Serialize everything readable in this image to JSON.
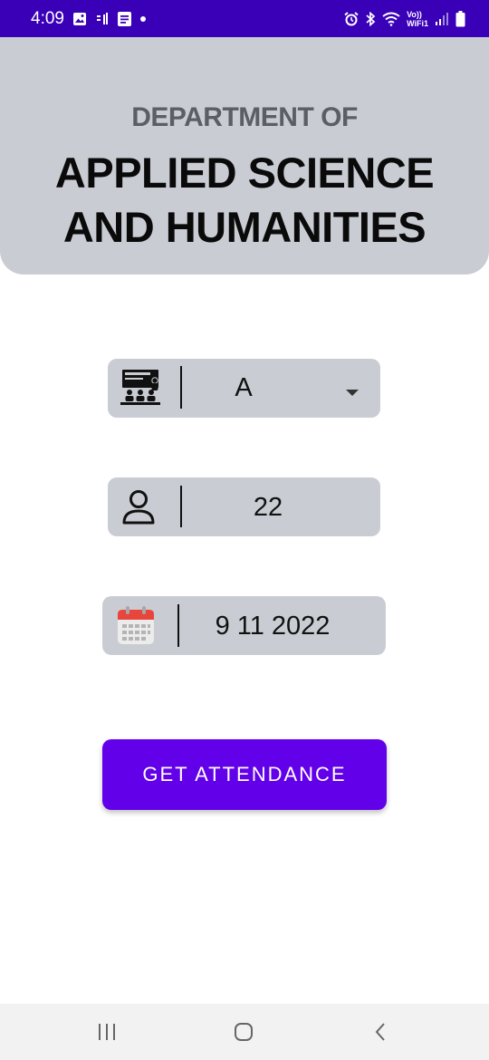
{
  "status_bar": {
    "time": "4:09",
    "network_label_top": "Vo))",
    "network_label_bottom": "WiFi1"
  },
  "header": {
    "subtitle": "DEPARTMENT OF",
    "title_line1": "APPLIED SCIENCE",
    "title_line2": "AND HUMANITIES"
  },
  "form": {
    "class_select": {
      "value": "A",
      "icon": "classroom-icon"
    },
    "roll_input": {
      "value": "22",
      "icon": "user-icon"
    },
    "date_input": {
      "value": "9 11 2022",
      "icon": "calendar-icon"
    },
    "submit_label": "GET ATTENDANCE"
  },
  "colors": {
    "status_bar": "#3a00b8",
    "header_bg": "#c9cdd3",
    "field_bg": "#c9cdd3",
    "accent": "#6200ea"
  }
}
